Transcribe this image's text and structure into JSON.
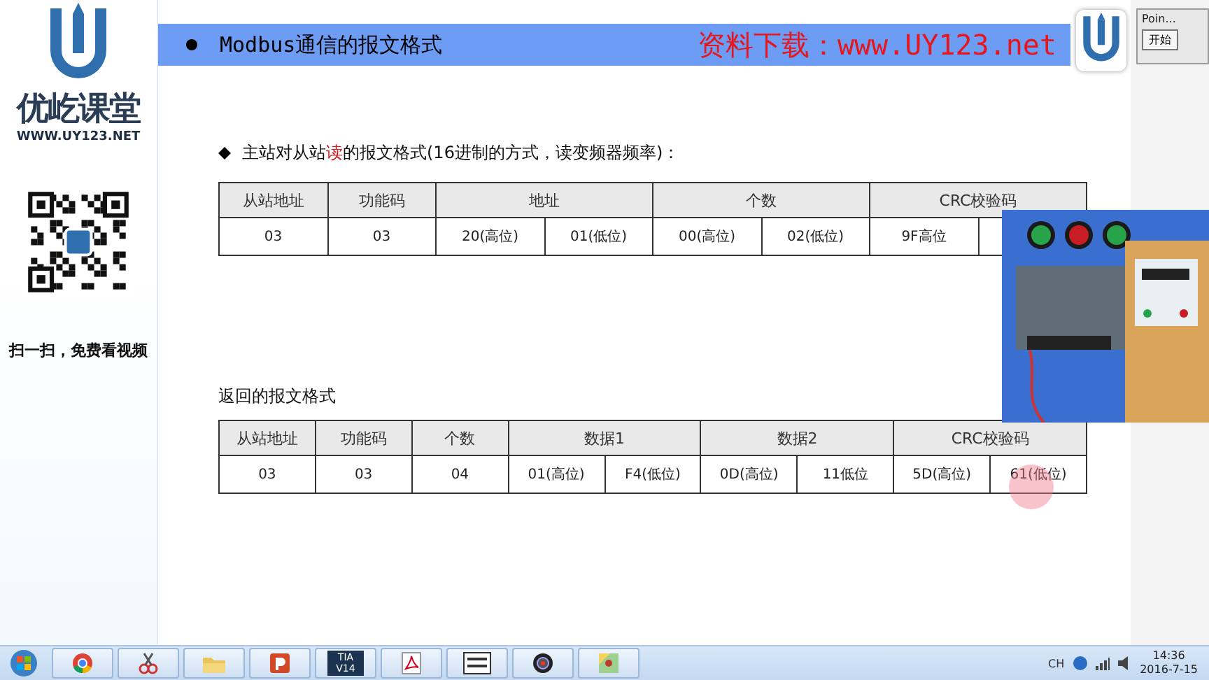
{
  "sidebar": {
    "brand": "优屹课堂",
    "url": "WWW.UY123.NET",
    "caption": "扫一扫，免费看视频"
  },
  "slide": {
    "title": "Modbus通信的报文格式",
    "banner": "资料下载：www.UY123.net",
    "tables": [
      {
        "heading": "主站对从站**读**的报文格式(16进制的方式，读变频器频率)：",
        "kind": "bulleted",
        "headers": [
          {
            "label": "从站地址",
            "kind": "single"
          },
          {
            "label": "功能码",
            "kind": "single"
          },
          {
            "label": "地址",
            "kind": "pair"
          },
          {
            "label": "个数",
            "kind": "pair"
          },
          {
            "label": "CRC校验码",
            "kind": "pair"
          }
        ],
        "cells": [
          "03",
          "03",
          "20(高位)",
          "01(低位)",
          "00(高位)",
          "02(低位)",
          "9F高位"
        ]
      },
      {
        "heading": "返回的报文格式",
        "kind": "plain",
        "headers": [
          {
            "label": "从站地址",
            "kind": "single"
          },
          {
            "label": "功能码",
            "kind": "single"
          },
          {
            "label": "个数",
            "kind": "single"
          },
          {
            "label": "数据1",
            "kind": "pair"
          },
          {
            "label": "数据2",
            "kind": "pair"
          },
          {
            "label": "CRC校验码",
            "kind": "pair"
          }
        ],
        "cells": [
          "03",
          "03",
          "04",
          "01(高位)",
          "F4(低位)",
          "0D(高位)",
          "11低位",
          "5D(高位)",
          "61(低位)"
        ]
      }
    ]
  },
  "point_window": {
    "title": "Poin...",
    "button": "开始"
  },
  "taskbar": {
    "apps": [
      {
        "kind": "chrome"
      },
      {
        "kind": "scissors"
      },
      {
        "kind": "folder"
      },
      {
        "kind": "powerpoint"
      },
      {
        "kind": "tia",
        "label": "TIA V14"
      },
      {
        "kind": "pdf"
      },
      {
        "kind": "modrun"
      },
      {
        "kind": "camera"
      },
      {
        "kind": "paint"
      }
    ],
    "tray": {
      "lang": "CH",
      "time": "14:36",
      "date": "2016-7-15"
    }
  }
}
